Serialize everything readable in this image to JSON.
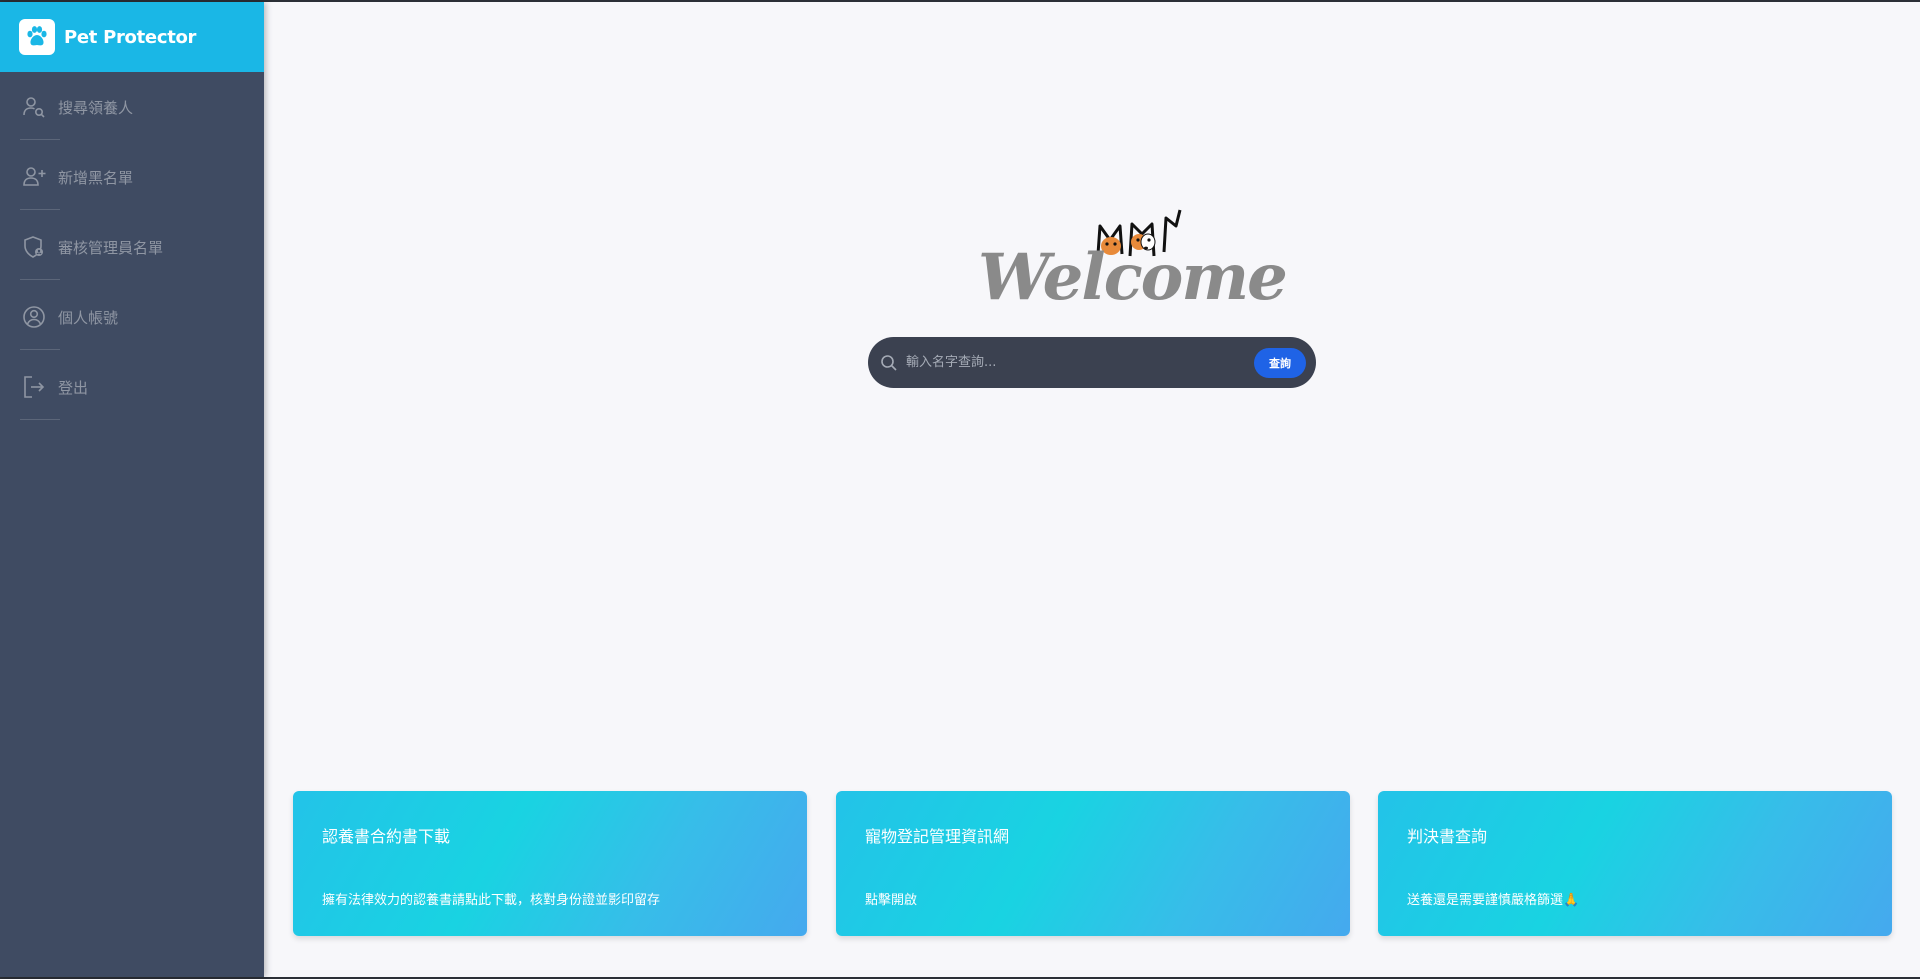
{
  "brand": {
    "title": "Pet Protector",
    "icon": "paw-icon"
  },
  "sidebar": {
    "items": [
      {
        "label": "搜尋領養人",
        "icon": "user-search-icon"
      },
      {
        "label": "新增黑名單",
        "icon": "user-add-icon"
      },
      {
        "label": "審核管理員名單",
        "icon": "shield-user-icon"
      },
      {
        "label": "個人帳號",
        "icon": "user-circle-icon"
      },
      {
        "label": "登出",
        "icon": "logout-icon"
      }
    ]
  },
  "main": {
    "welcome": "Welcome",
    "search": {
      "placeholder": "輸入名字查詢...",
      "button": "查詢"
    },
    "cards": [
      {
        "title": "認養書合約書下載",
        "desc": "擁有法律效力的認養書請點此下載，核對身份證並影印留存"
      },
      {
        "title": "寵物登記管理資訊網",
        "desc": "點擊開啟"
      },
      {
        "title": "判決書查詢",
        "desc": "送養還是需要謹慎嚴格篩選🙏"
      }
    ]
  },
  "colors": {
    "sidebar_bg": "#3f4b62",
    "brand_bg": "#1ab7e6",
    "search_button": "#1f63e6",
    "card_gradient_start": "#23c3e8",
    "card_gradient_end": "#45a9ee"
  }
}
